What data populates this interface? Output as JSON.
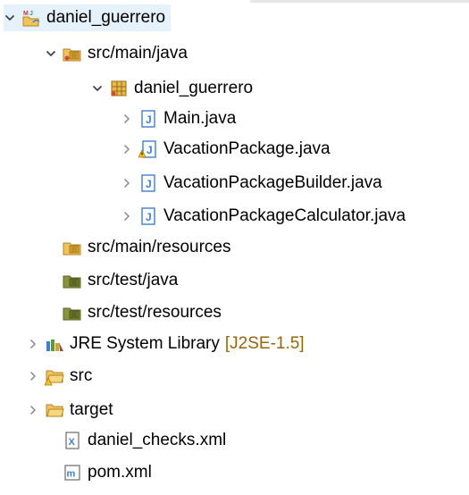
{
  "tree": {
    "root": {
      "label": "daniel_guerrero",
      "icon": "maven-java-project-icon",
      "expanded": true
    },
    "children": [
      {
        "label": "src/main/java",
        "icon": "source-folder-icon",
        "expanded": true,
        "children": [
          {
            "label": "daniel_guerrero",
            "icon": "package-icon",
            "expanded": true,
            "children": [
              {
                "label": "Main.java",
                "icon": "java-file-icon",
                "expanded": false
              },
              {
                "label": "VacationPackage.java",
                "icon": "java-file-warning-icon",
                "expanded": false
              },
              {
                "label": "VacationPackageBuilder.java",
                "icon": "java-file-icon",
                "expanded": false
              },
              {
                "label": "VacationPackageCalculator.java",
                "icon": "java-file-icon",
                "expanded": false
              }
            ]
          }
        ]
      },
      {
        "label": "src/main/resources",
        "icon": "source-folder-icon"
      },
      {
        "label": "src/test/java",
        "icon": "source-folder-icon"
      },
      {
        "label": "src/test/resources",
        "icon": "source-folder-icon"
      },
      {
        "label": "JRE System Library",
        "decoration": "[J2SE-1.5]",
        "icon": "library-icon",
        "expanded": false
      },
      {
        "label": "src",
        "icon": "folder-warning-icon",
        "expanded": false
      },
      {
        "label": "target",
        "icon": "folder-icon",
        "expanded": false
      },
      {
        "label": "daniel_checks.xml",
        "icon": "xml-file-icon"
      },
      {
        "label": "pom.xml",
        "icon": "maven-pom-icon"
      }
    ]
  },
  "colors": {
    "selection": "#e5f1fb",
    "decoration": "#95650f",
    "folder": "#e8b94a",
    "source_folder_dark": "#6e7a2f",
    "java_blue": "#3f7fcb"
  }
}
